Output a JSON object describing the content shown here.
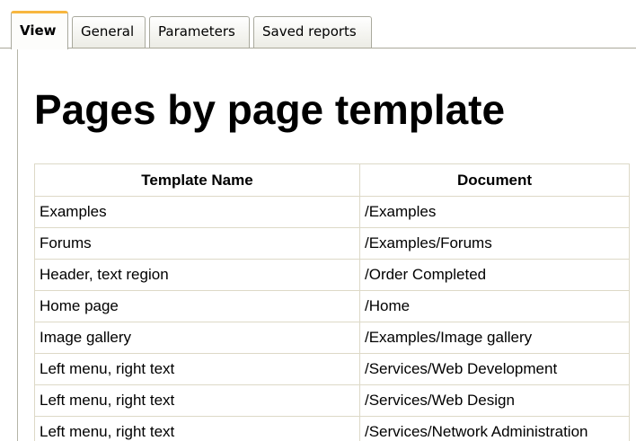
{
  "tabs": [
    {
      "label": "View",
      "active": true
    },
    {
      "label": "General",
      "active": false
    },
    {
      "label": "Parameters",
      "active": false
    },
    {
      "label": "Saved reports",
      "active": false
    }
  ],
  "report": {
    "title": "Pages by page template",
    "columns": [
      "Template Name",
      "Document"
    ],
    "rows": [
      [
        "Examples",
        "/Examples"
      ],
      [
        "Forums",
        "/Examples/Forums"
      ],
      [
        "Header, text region",
        "/Order Completed"
      ],
      [
        "Home page",
        "/Home"
      ],
      [
        "Image gallery",
        "/Examples/Image gallery"
      ],
      [
        "Left menu, right text",
        "/Services/Web Development"
      ],
      [
        "Left menu, right text",
        "/Services/Web Design"
      ],
      [
        "Left menu, right text",
        "/Services/Network Administration"
      ]
    ]
  },
  "colors": {
    "active_tab_accent": "#f7b63e",
    "table_border": "#ddd9c7",
    "tab_border": "#a9a99d"
  }
}
